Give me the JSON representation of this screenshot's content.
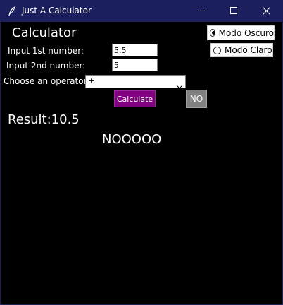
{
  "window": {
    "title": "Just A Calculator",
    "title_bar_color": "#1b1f5e",
    "background_color": "#000000",
    "icons": {
      "app": "feather-icon",
      "minimize": "minimize-icon",
      "maximize": "maximize-icon",
      "close": "close-icon"
    }
  },
  "calculator": {
    "heading": "Calculator",
    "first_label": "Input 1st number:",
    "first_value": "5.5",
    "second_label": "Input 2nd number:",
    "second_value": "5",
    "operator_label": "Choose an operator",
    "operator_value": "+",
    "calculate_label": "Calculate",
    "calculate_color": "#800080",
    "no_label": "NO",
    "no_color": "#808080",
    "result_text": "Result:10.5",
    "message_text": "NOOOOO"
  },
  "theme": {
    "dark_label": "Modo Oscuro",
    "dark_selected": true,
    "light_label": "Modo Claro",
    "light_selected": false
  }
}
